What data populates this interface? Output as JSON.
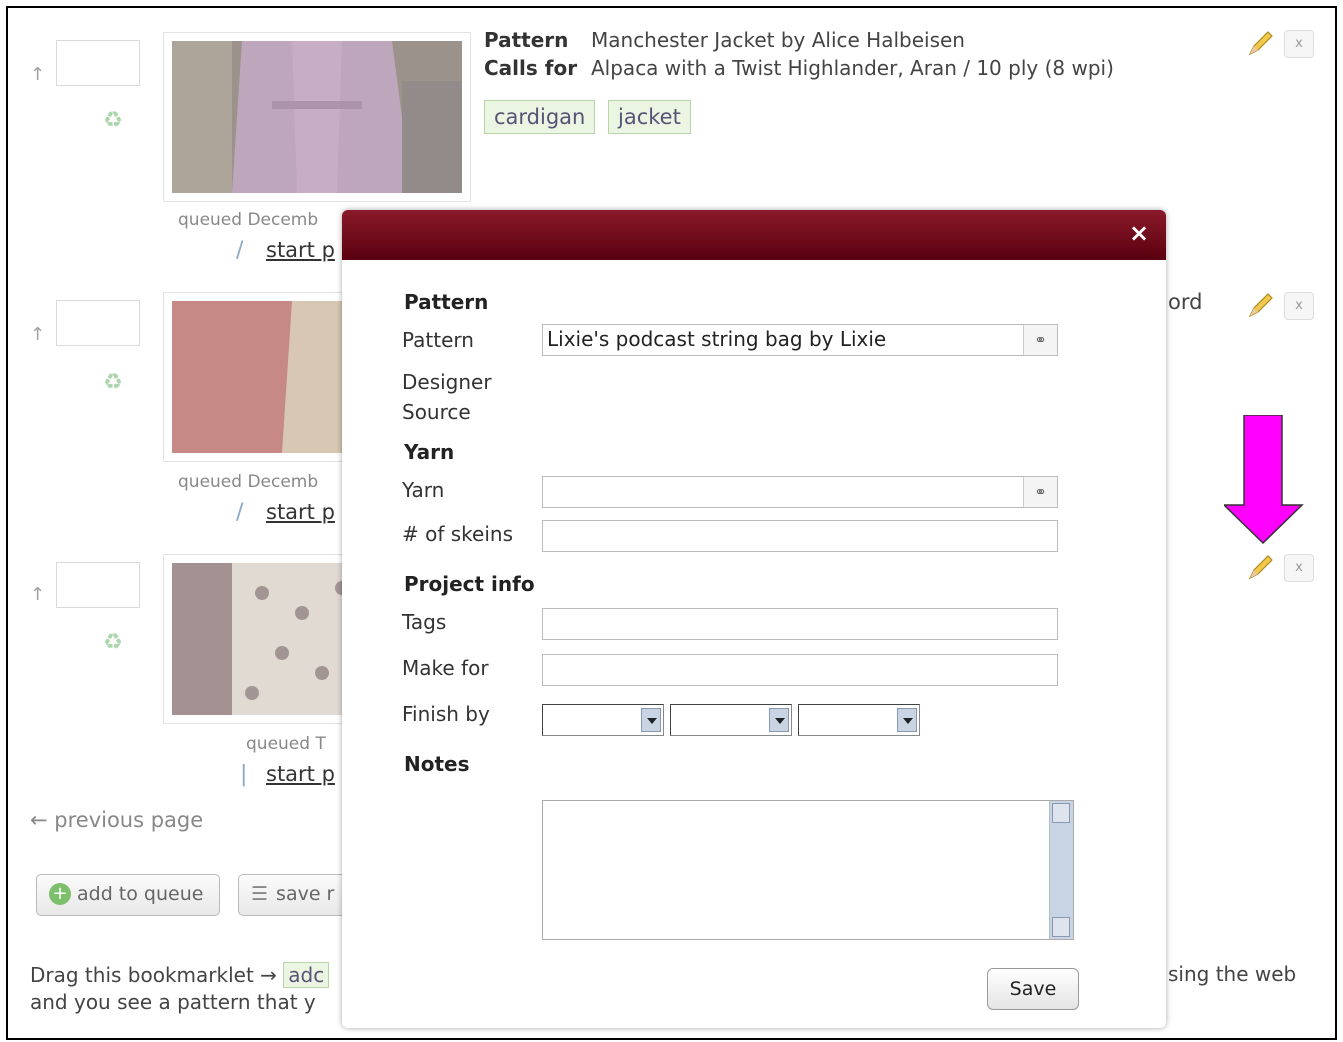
{
  "queue_items": [
    {
      "pattern_label": "Pattern",
      "pattern_value": "Manchester Jacket by Alice Halbeisen",
      "calls_for_label": "Calls for",
      "calls_for_value": "Alpaca with a Twist Highlander, Aran / 10 ply (8 wpi)",
      "tags": [
        "cardigan",
        "jacket"
      ],
      "queued": "queued Decemb",
      "start": "start p"
    },
    {
      "partial_text": "ord",
      "queued": "queued Decemb",
      "start": "start p"
    },
    {
      "queued": "queued T",
      "start": "start p"
    }
  ],
  "footer": {
    "previous_page": "← previous page",
    "add_to_queue": "add to queue",
    "save": "save r",
    "drag_line1": "Drag this bookmarklet →",
    "bookmarklet": "adc",
    "drag_line2": "and you see a pattern that y",
    "sing_the_web": "sing the web"
  },
  "modal": {
    "close": "×",
    "section_pattern": "Pattern",
    "pattern_label": "Pattern",
    "pattern_value": "Lixie's podcast string bag by Lixie",
    "designer_label": "Designer",
    "source_label": "Source",
    "section_yarn": "Yarn",
    "yarn_label": "Yarn",
    "yarn_value": "",
    "skeins_label": "# of skeins",
    "skeins_value": "",
    "section_project": "Project info",
    "tags_label": "Tags",
    "tags_value": "",
    "make_for_label": "Make for",
    "make_for_value": "",
    "finish_by_label": "Finish by",
    "section_notes": "Notes",
    "notes_value": "",
    "save_label": "Save"
  },
  "icons": {
    "up": "↑",
    "recycle": "♻",
    "pencil": "pencil-icon",
    "x": "x",
    "link": "⚭"
  },
  "colors": {
    "modal_header_top": "#8a1a2a",
    "modal_header_bottom": "#5a0010",
    "highlight_arrow": "#ff00ff",
    "tag_bg": "#eaf5e2"
  }
}
